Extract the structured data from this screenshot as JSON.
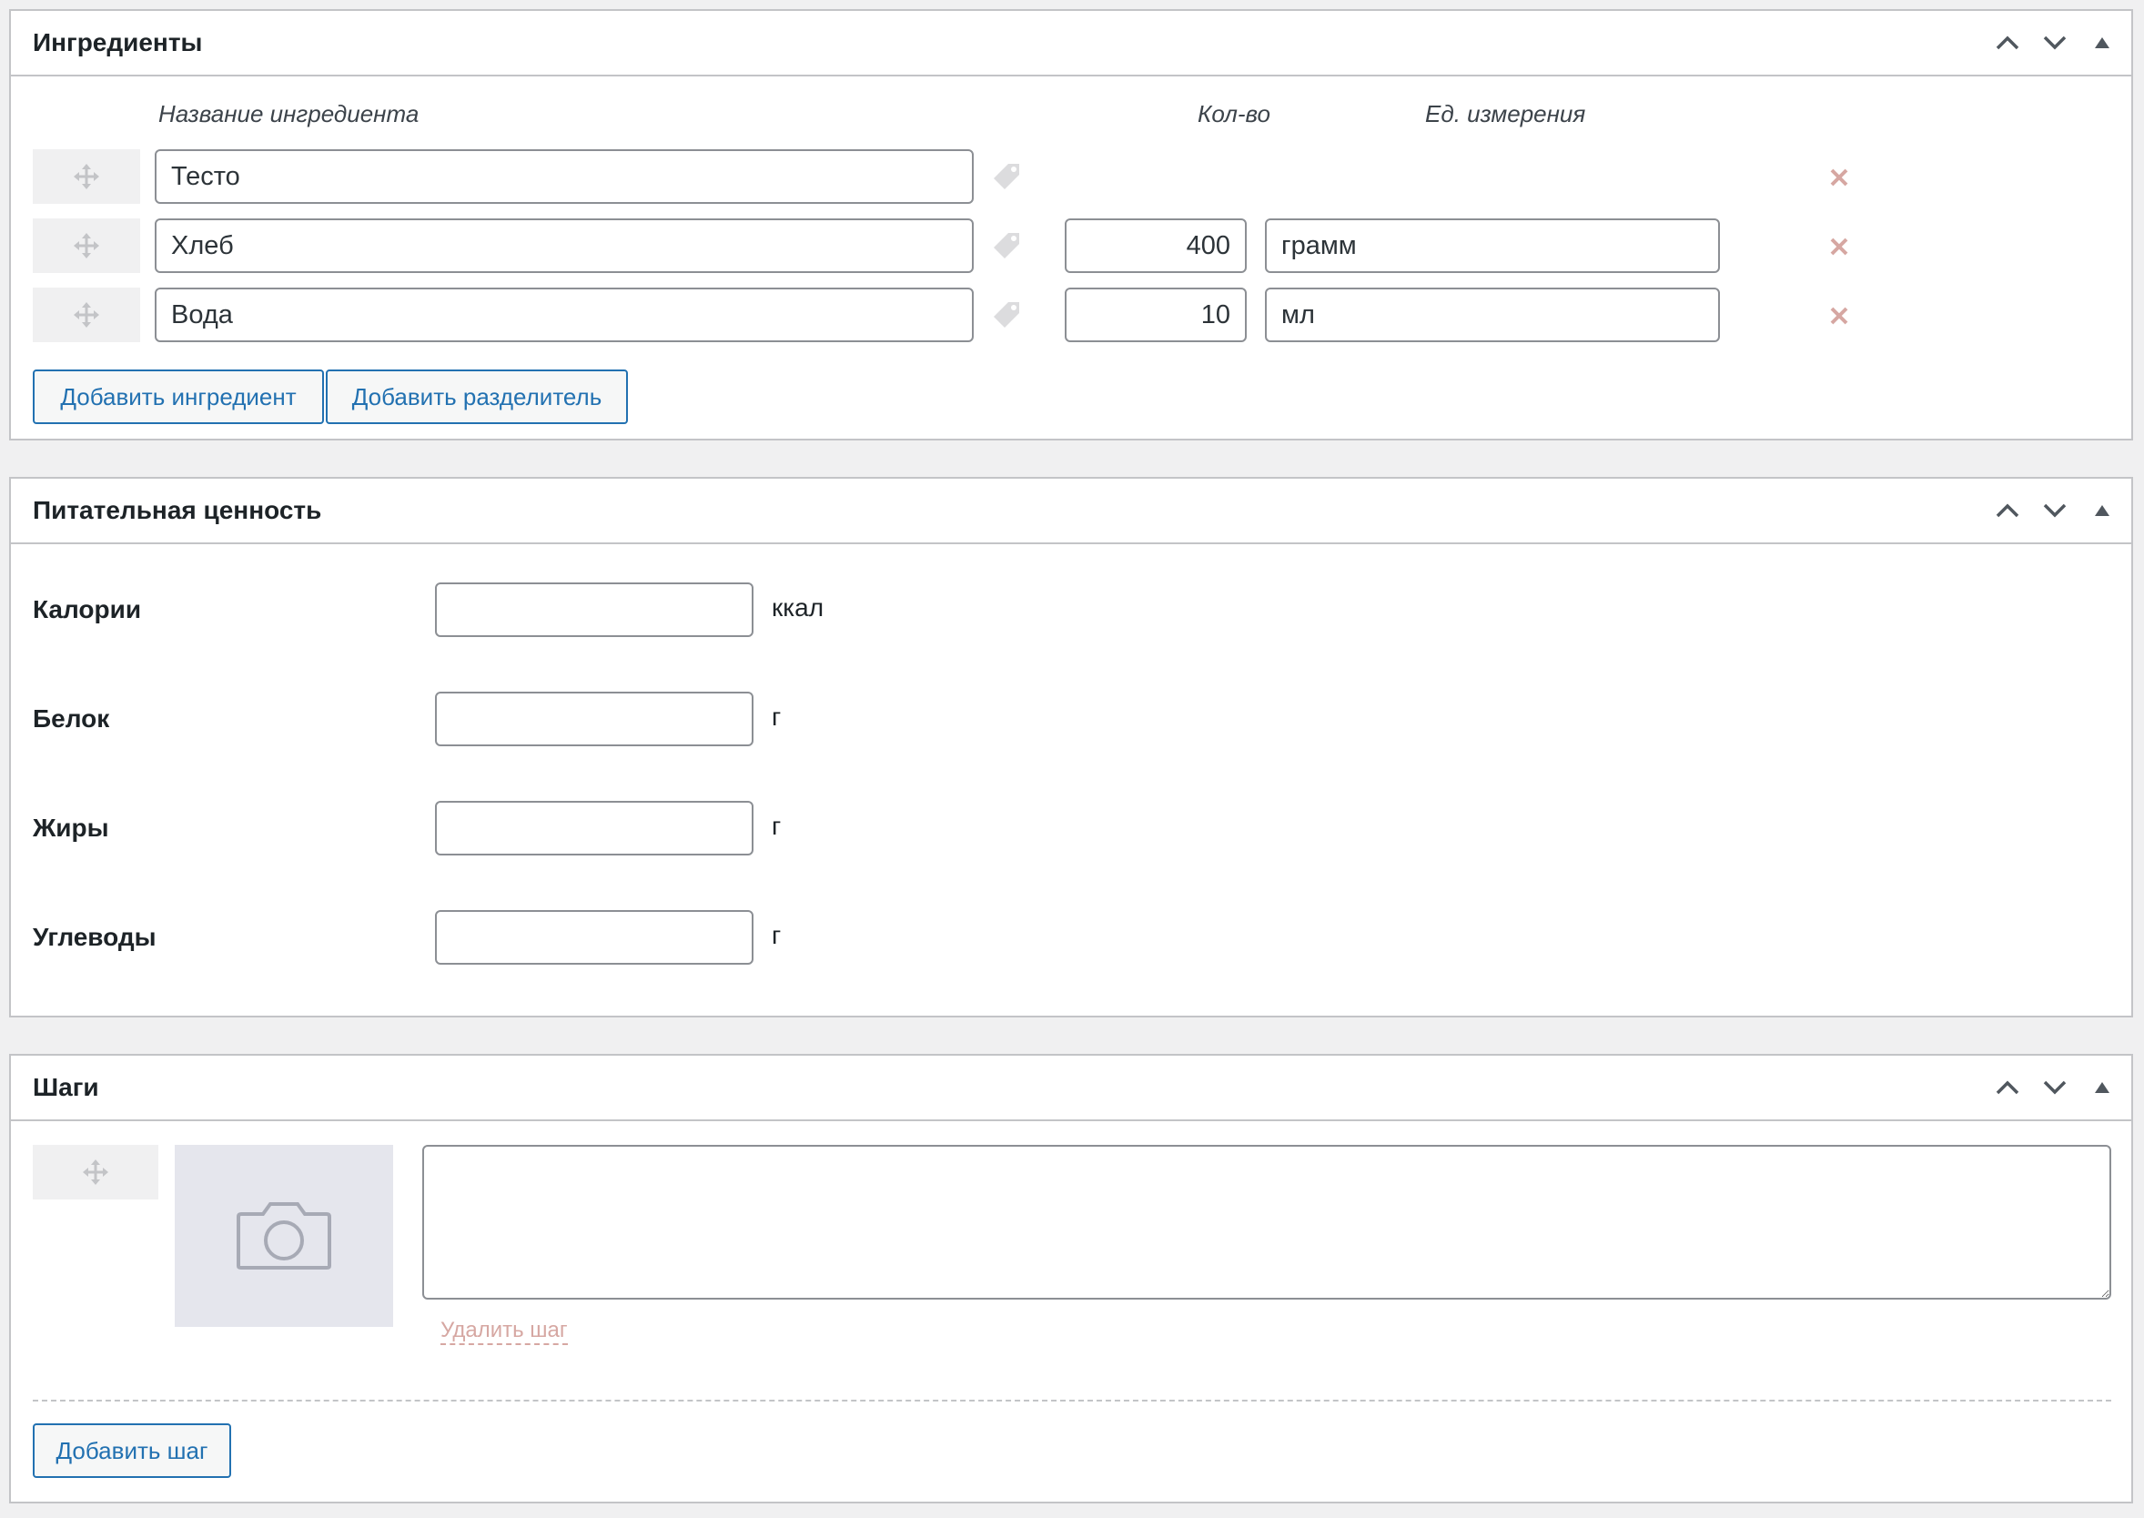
{
  "ingredients_box": {
    "title": "Ингредиенты",
    "col_name": "Название ингредиента",
    "col_qty": "Кол-во",
    "col_unit": "Ед. измерения",
    "rows": [
      {
        "name": "Тесто",
        "qty": "",
        "unit": ""
      },
      {
        "name": "Хлеб",
        "qty": "400",
        "unit": "грамм"
      },
      {
        "name": "Вода",
        "qty": "10",
        "unit": "мл"
      }
    ],
    "add_ingredient_label": "Добавить ингредиент",
    "add_separator_label": "Добавить разделитель"
  },
  "nutrition_box": {
    "title": "Питательная ценность",
    "fields": [
      {
        "label": "Калории",
        "value": "",
        "unit": "ккал"
      },
      {
        "label": "Белок",
        "value": "",
        "unit": "г"
      },
      {
        "label": "Жиры",
        "value": "",
        "unit": "г"
      },
      {
        "label": "Углеводы",
        "value": "",
        "unit": "г"
      }
    ]
  },
  "steps_box": {
    "title": "Шаги",
    "steps": [
      {
        "text": "",
        "delete_label": "Удалить шаг"
      }
    ],
    "add_step_label": "Добавить шаг"
  },
  "icons": {
    "drag": "move-arrows-icon",
    "tag": "tag-icon",
    "remove": "remove-x-icon",
    "photo": "camera-icon",
    "move_up": "chevron-up-icon",
    "move_down": "chevron-down-icon",
    "toggle": "triangle-up-icon"
  },
  "colors": {
    "accent": "#2271b1",
    "border": "#c3c4c7",
    "background": "#f0f0f1",
    "remove": "#d6a7a2",
    "photo_bg": "#e5e6ed"
  }
}
